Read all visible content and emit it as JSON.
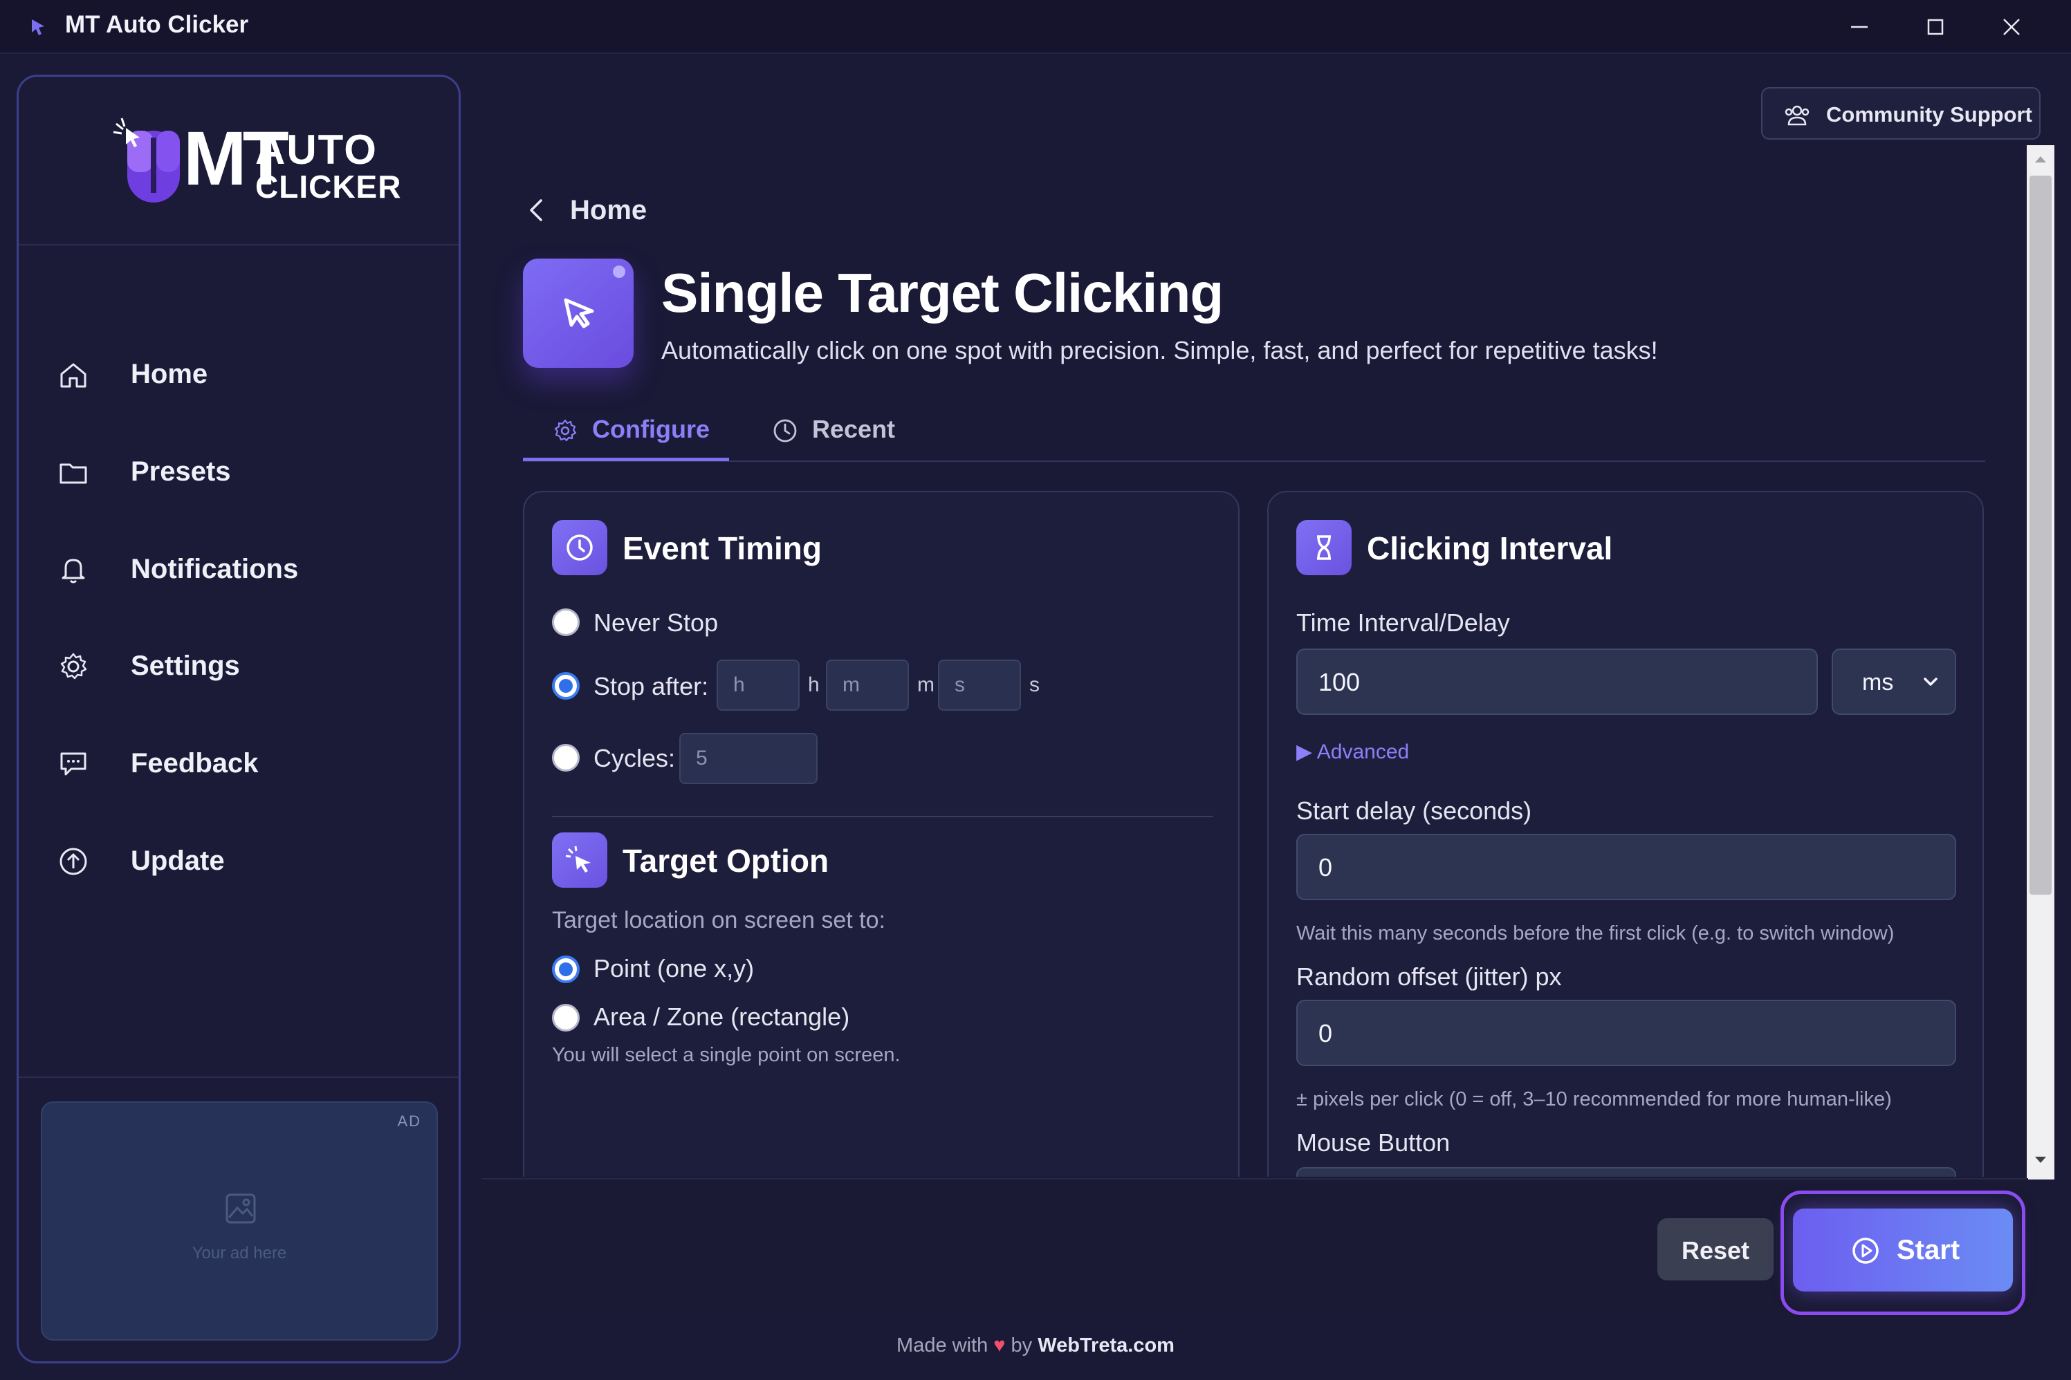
{
  "window": {
    "title": "MT Auto Clicker"
  },
  "logo": {
    "mt": "MT",
    "auto": "AUTO",
    "clicker": "CLICKER"
  },
  "sidebar": {
    "items": [
      {
        "label": "Home",
        "icon": "home-icon"
      },
      {
        "label": "Presets",
        "icon": "folder-icon"
      },
      {
        "label": "Notifications",
        "icon": "bell-icon"
      },
      {
        "label": "Settings",
        "icon": "gear-icon"
      },
      {
        "label": "Feedback",
        "icon": "message-icon"
      },
      {
        "label": "Update",
        "icon": "upload-icon"
      }
    ],
    "ad": {
      "tag": "AD",
      "text": "Your ad here"
    }
  },
  "header": {
    "community_label": "Community Support",
    "back_label": "Home",
    "title": "Single Target Clicking",
    "subtitle": "Automatically click on one spot with precision. Simple, fast, and perfect for repetitive tasks!"
  },
  "tabs": [
    {
      "label": "Configure",
      "active": true
    },
    {
      "label": "Recent",
      "active": false
    }
  ],
  "event_timing": {
    "title": "Event Timing",
    "never_stop": "Never Stop",
    "stop_after": "Stop after:",
    "h_placeholder": "h",
    "h_unit": "h",
    "m_placeholder": "m",
    "m_unit": "m",
    "s_placeholder": "s",
    "s_unit": "s",
    "cycles": "Cycles:",
    "cycles_value": "5",
    "selected": "stop_after"
  },
  "target_option": {
    "title": "Target Option",
    "description": "Target location on screen set to:",
    "point": "Point (one x,y)",
    "area": "Area / Zone (rectangle)",
    "helper": "You will select a single point on screen.",
    "selected": "point"
  },
  "clicking_interval": {
    "title": "Clicking Interval",
    "interval_label": "Time Interval/Delay",
    "interval_value": "100",
    "unit": "ms",
    "advanced": "Advanced",
    "start_delay_label": "Start delay (seconds)",
    "start_delay_value": "0",
    "start_delay_help": "Wait this many seconds before the first click (e.g. to switch window)",
    "jitter_label": "Random offset (jitter) px",
    "jitter_value": "0",
    "jitter_help": "± pixels per click (0 = off, 3–10 recommended for more human-like)",
    "mouse_button_label": "Mouse Button"
  },
  "actions": {
    "reset": "Reset",
    "start": "Start"
  },
  "footer": {
    "made_with": "Made with",
    "by": "by",
    "brand": "WebTreta.com"
  },
  "colors": {
    "accent": "#7d70f0",
    "background": "#1a1936",
    "radio_selected": "#2f6fe8"
  }
}
